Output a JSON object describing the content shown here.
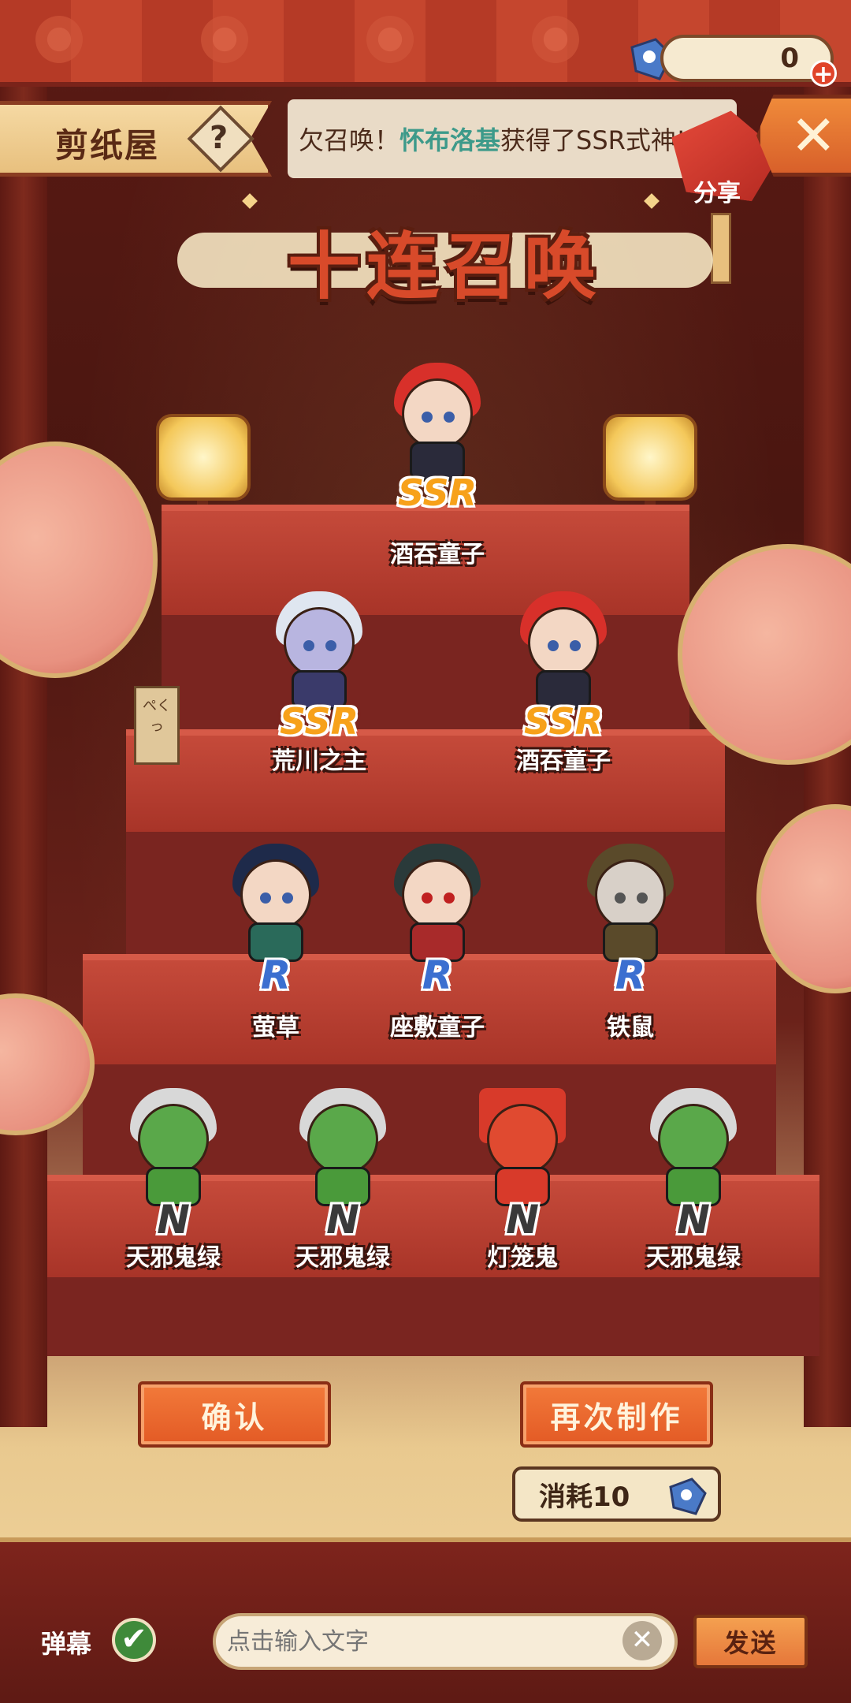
{
  "header": {
    "shop_label": "剪纸屋",
    "help_label": "?",
    "currency_amount": "0",
    "currency_plus": "+",
    "close_label": "✕",
    "share_label": "分享"
  },
  "marquee": {
    "prefix": "欠召唤！",
    "player": "怀布洛基",
    "suffix": "获得了SSR式神!"
  },
  "banner": {
    "title": "十连召唤"
  },
  "wood_tag": "ぺくっ",
  "results": [
    {
      "rarity": "SSR",
      "name": "酒吞童子",
      "hair": "#d8302a",
      "outfit": "#2a2a3a"
    },
    {
      "rarity": "SSR",
      "name": "荒川之主",
      "hair": "#dfe6f0",
      "outfit": "#3a3a6a"
    },
    {
      "rarity": "SSR",
      "name": "酒吞童子",
      "hair": "#d8302a",
      "outfit": "#2a2a3a"
    },
    {
      "rarity": "R",
      "name": "萤草",
      "hair": "#1e2a4a",
      "outfit": "#2a6a5a"
    },
    {
      "rarity": "R",
      "name": "座敷童子",
      "hair": "#2a3a3a",
      "outfit": "#a82a2a"
    },
    {
      "rarity": "R",
      "name": "铁鼠",
      "hair": "#8a7a6a",
      "outfit": "#5a4a2a"
    },
    {
      "rarity": "N",
      "name": "天邪鬼绿",
      "hair": "#d8d8d8",
      "outfit": "#4a9a3a"
    },
    {
      "rarity": "N",
      "name": "天邪鬼绿",
      "hair": "#d8d8d8",
      "outfit": "#4a9a3a"
    },
    {
      "rarity": "N",
      "name": "灯笼鬼",
      "hair": "#d83a2a",
      "outfit": "#d83a2a"
    },
    {
      "rarity": "N",
      "name": "天邪鬼绿",
      "hair": "#d8d8d8",
      "outfit": "#4a9a3a"
    }
  ],
  "actions": {
    "confirm_label": "确认",
    "again_label": "再次制作",
    "cost_label": "消耗10"
  },
  "chat": {
    "danmu_label": "弹幕",
    "danmu_checked": "✔",
    "placeholder": "点击输入文字",
    "clear_label": "✕",
    "send_label": "发送"
  },
  "colors": {
    "accent_orange": "#e35a25",
    "ssr_gold": "#f7a11a",
    "r_blue": "#3b6fd0",
    "stair_red": "#b03a2e"
  }
}
